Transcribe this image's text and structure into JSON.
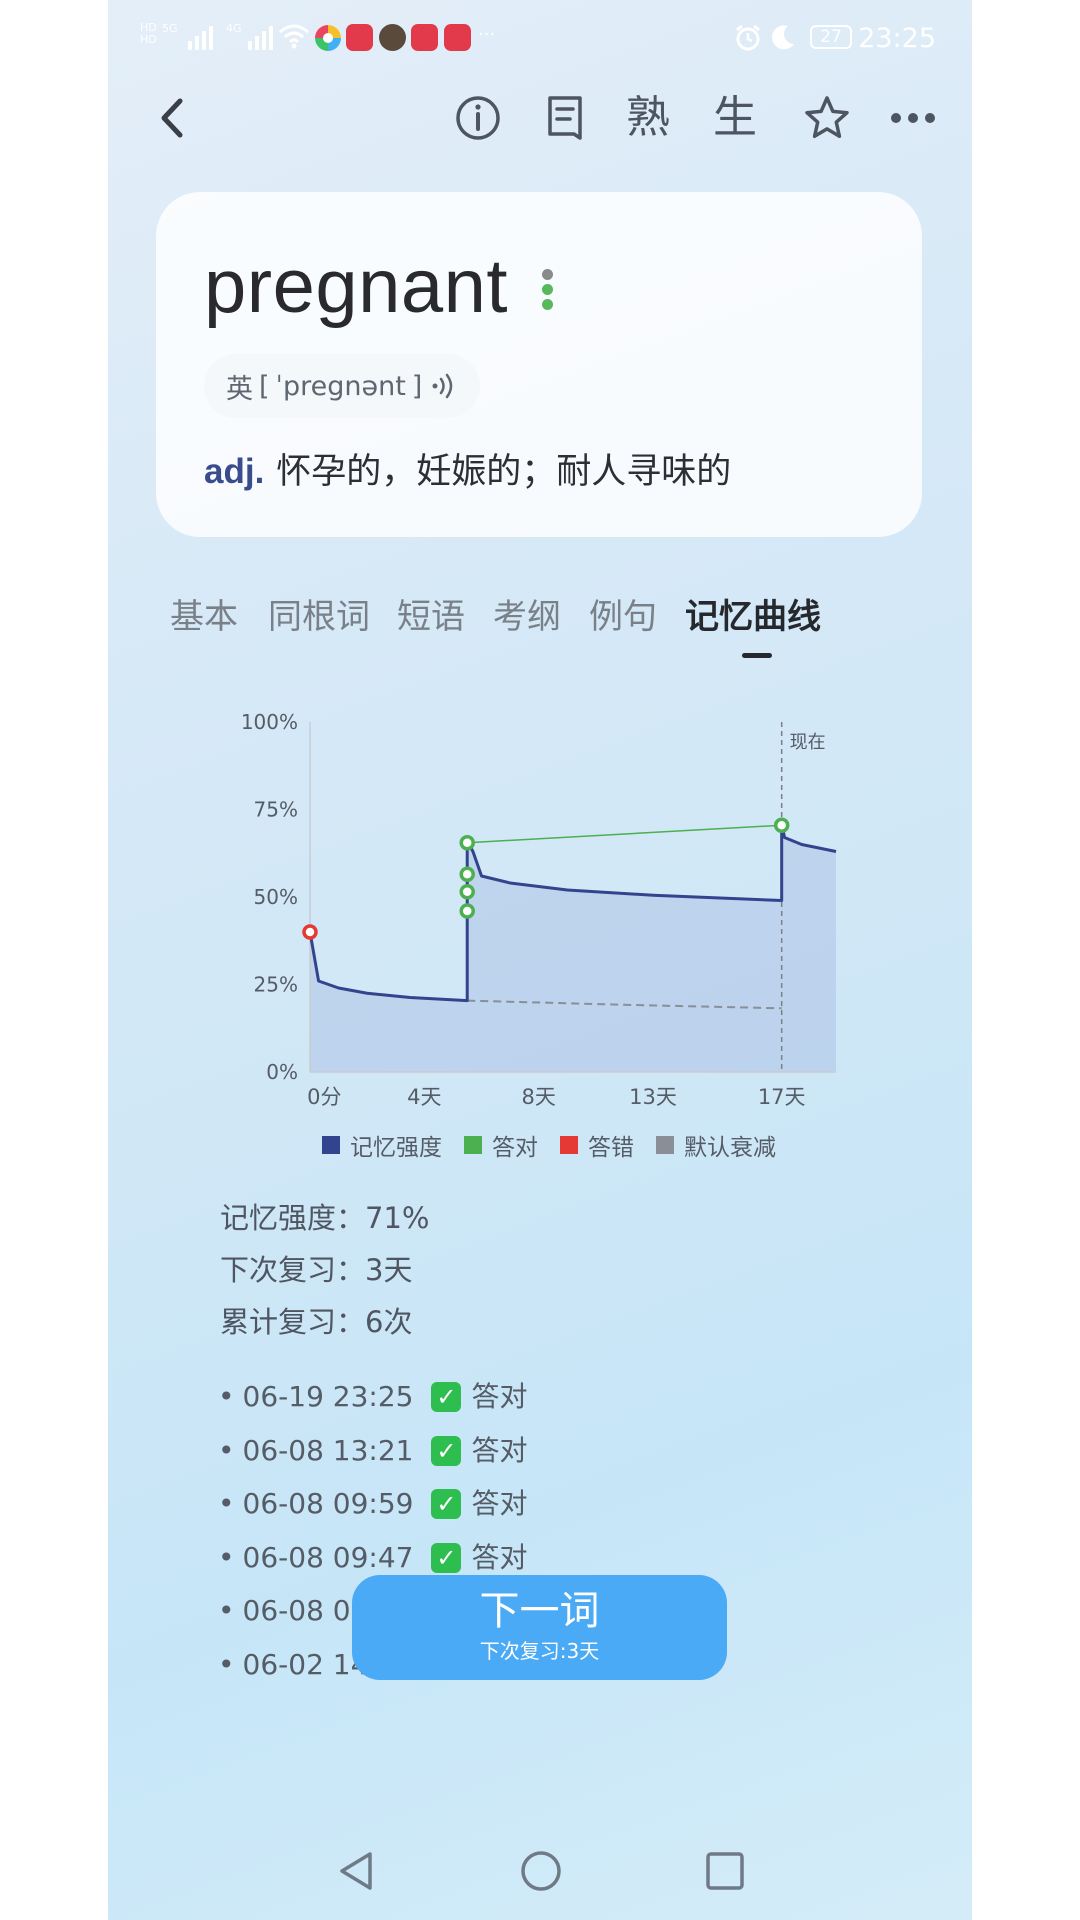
{
  "status_bar": {
    "left_labels": [
      "5G",
      "4G"
    ],
    "battery": "27",
    "time": "23:25",
    "app_icon_colors": [
      "#e33a4b",
      "#e33a4b",
      "#e33a4b"
    ]
  },
  "top_nav": {
    "back_icon": "chevron-left-icon",
    "info_icon": "info-icon",
    "note_icon": "notebook-icon",
    "familiar_label": "熟",
    "new_label": "生",
    "star_icon": "star-outline-icon",
    "more_icon": "more-icon"
  },
  "word_card": {
    "word": "pregnant",
    "phonetic_region": "英",
    "phonetic_open": "[",
    "phonetic": "ˈpregnənt",
    "phonetic_close": "]",
    "audio_icon": "speaker-icon",
    "part_of_speech": "adj.",
    "definition": "怀孕的，妊娠的；耐人寻味的",
    "level_dot_colors": [
      "#8a8a8a",
      "#58b85c",
      "#58b85c"
    ]
  },
  "tabs": [
    {
      "label": "基本",
      "active": false
    },
    {
      "label": "同根词",
      "active": false
    },
    {
      "label": "短语",
      "active": false
    },
    {
      "label": "考纲",
      "active": false
    },
    {
      "label": "例句",
      "active": false
    },
    {
      "label": "记忆曲线",
      "active": true
    }
  ],
  "chart_data": {
    "type": "line",
    "title": "",
    "xlabel": "",
    "ylabel": "",
    "x_unit": "days",
    "xlim": [
      0,
      18.4
    ],
    "ylim": [
      0,
      100
    ],
    "y_ticks": [
      "0%",
      "25%",
      "50%",
      "75%",
      "100%"
    ],
    "y_tick_values": [
      0,
      25,
      50,
      75,
      100
    ],
    "x_ticks": [
      "0分",
      "4天",
      "8天",
      "13天",
      "17天"
    ],
    "x_tick_values": [
      0.5,
      4,
      8,
      12,
      16.5
    ],
    "now_label": "现在",
    "now_x": 16.5,
    "grid": false,
    "legend_position": "bottom",
    "series": [
      {
        "name": "记忆强度",
        "color": "#33448e",
        "points": [
          [
            0,
            40
          ],
          [
            0.3,
            26
          ],
          [
            1,
            24
          ],
          [
            2,
            22.5
          ],
          [
            3.5,
            21.3
          ],
          [
            5.5,
            20.4
          ],
          [
            5.5,
            66
          ],
          [
            5.7,
            63
          ],
          [
            6,
            56
          ],
          [
            7,
            54
          ],
          [
            9,
            52
          ],
          [
            12,
            50.5
          ],
          [
            16.5,
            49
          ],
          [
            16.5,
            71
          ],
          [
            16.6,
            67
          ],
          [
            17.2,
            65
          ],
          [
            18.4,
            63
          ]
        ]
      },
      {
        "name": "答对",
        "color": "#4caf50",
        "points": [
          [
            5.5,
            46
          ],
          [
            5.5,
            51.5
          ],
          [
            5.5,
            56.5
          ],
          [
            5.5,
            65.5
          ],
          [
            16.5,
            70.5
          ]
        ]
      },
      {
        "name": "答错",
        "color": "#e53935",
        "points": [
          [
            0,
            40
          ]
        ]
      },
      {
        "name": "默认衰减",
        "color": "#8a8e96",
        "points": [
          [
            5.5,
            20.4
          ],
          [
            11,
            19.2
          ],
          [
            16.5,
            18.2
          ]
        ]
      }
    ]
  },
  "stats": {
    "strength": "记忆强度：71%",
    "next_review": "下次复习：3天",
    "total_reviews": "累计复习：6次"
  },
  "review_log": [
    {
      "time": "06-19 23:25",
      "result": "答对",
      "icon": "check-icon"
    },
    {
      "time": "06-08 13:21",
      "result": "答对",
      "icon": "check-icon"
    },
    {
      "time": "06-08 09:59",
      "result": "答对",
      "icon": "check-icon"
    },
    {
      "time": "06-08 09:47",
      "result": "答对",
      "icon": "check-icon"
    },
    {
      "time": "06-08 09:",
      "result": "",
      "icon": ""
    },
    {
      "time": "06-02 14:4",
      "result": "",
      "icon": ""
    }
  ],
  "log_bullet": "•",
  "next_button": {
    "label": "下一词",
    "sublabel": "下次复习:3天"
  },
  "bottom_nav": [
    "back-triangle-icon",
    "home-circle-icon",
    "recents-square-icon"
  ]
}
